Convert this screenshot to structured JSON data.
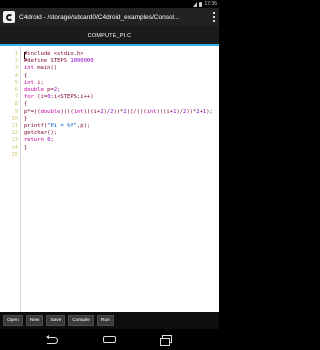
{
  "status_bar": {
    "time": "17:36"
  },
  "title_bar": {
    "title": "C4droid - /storage/sdcard0/C4droid_examples/Consol..."
  },
  "tab": {
    "label": "COMPUTE_PI.C"
  },
  "editor": {
    "lines": [
      {
        "num": "1",
        "parts": [
          [
            "p",
            "#include <stdio.h>"
          ]
        ]
      },
      {
        "num": "2",
        "parts": [
          [
            "p",
            "#define STEPS "
          ],
          [
            "n",
            "1000000"
          ]
        ]
      },
      {
        "num": "3",
        "parts": [
          [
            "k",
            "int"
          ],
          [
            "p",
            " main()"
          ]
        ]
      },
      {
        "num": "4",
        "parts": [
          [
            "p",
            "{"
          ]
        ]
      },
      {
        "num": "5",
        "parts": [
          [
            "k",
            "int"
          ],
          [
            "p",
            " i;"
          ]
        ]
      },
      {
        "num": "6",
        "parts": [
          [
            "k",
            "double"
          ],
          [
            "p",
            " p="
          ],
          [
            "n",
            "2"
          ],
          [
            "p",
            ";"
          ]
        ]
      },
      {
        "num": "7",
        "parts": [
          [
            "k",
            "for"
          ],
          [
            "p",
            " (i="
          ],
          [
            "n",
            "0"
          ],
          [
            "p",
            ";i<STEPS;i++)"
          ]
        ]
      },
      {
        "num": "8",
        "parts": [
          [
            "p",
            "{"
          ]
        ]
      },
      {
        "num": "9",
        "parts": [
          [
            "p",
            "p*=(("
          ],
          [
            "k",
            "double"
          ],
          [
            "p",
            ")((("
          ],
          [
            "k",
            "int"
          ],
          [
            "p",
            ")((i+"
          ],
          [
            "n",
            "2"
          ],
          [
            "p",
            ")/"
          ],
          [
            "n",
            "2"
          ],
          [
            "p",
            "))*"
          ],
          [
            "n",
            "2"
          ],
          [
            "p",
            "))/((("
          ],
          [
            "k",
            "int"
          ],
          [
            "p",
            ")((i+"
          ],
          [
            "n",
            "1"
          ],
          [
            "p",
            ")/"
          ],
          [
            "n",
            "2"
          ],
          [
            "p",
            "))*"
          ],
          [
            "n",
            "2"
          ],
          [
            "p",
            "+"
          ],
          [
            "n",
            "1"
          ],
          [
            "p",
            ");"
          ]
        ]
      },
      {
        "num": "10",
        "parts": [
          [
            "p",
            "}"
          ]
        ]
      },
      {
        "num": "11",
        "parts": [
          [
            "p",
            "printf("
          ],
          [
            "s",
            "\"Pi = %f\""
          ],
          [
            "p",
            ",p);"
          ]
        ]
      },
      {
        "num": "12",
        "parts": [
          [
            "p",
            "getchar();"
          ]
        ]
      },
      {
        "num": "13",
        "parts": [
          [
            "k",
            "return"
          ],
          [
            "p",
            " "
          ],
          [
            "n",
            "0"
          ],
          [
            "p",
            ";"
          ]
        ]
      },
      {
        "num": "14",
        "parts": [
          [
            "p",
            "}"
          ]
        ]
      },
      {
        "num": "15",
        "parts": []
      }
    ]
  },
  "toolbar": {
    "buttons": [
      {
        "id": "open",
        "label": "Open"
      },
      {
        "id": "new",
        "label": "New"
      },
      {
        "id": "save",
        "label": "Save"
      },
      {
        "id": "compile",
        "label": "Compile"
      },
      {
        "id": "run",
        "label": "Run"
      }
    ]
  },
  "colors": {
    "accent": "#33b5e5",
    "line_numbers": "#d4c56a",
    "keyword": "#c800a0",
    "number": "#8a00c8",
    "string": "#0050c8",
    "plain_code": "#7a0032"
  }
}
